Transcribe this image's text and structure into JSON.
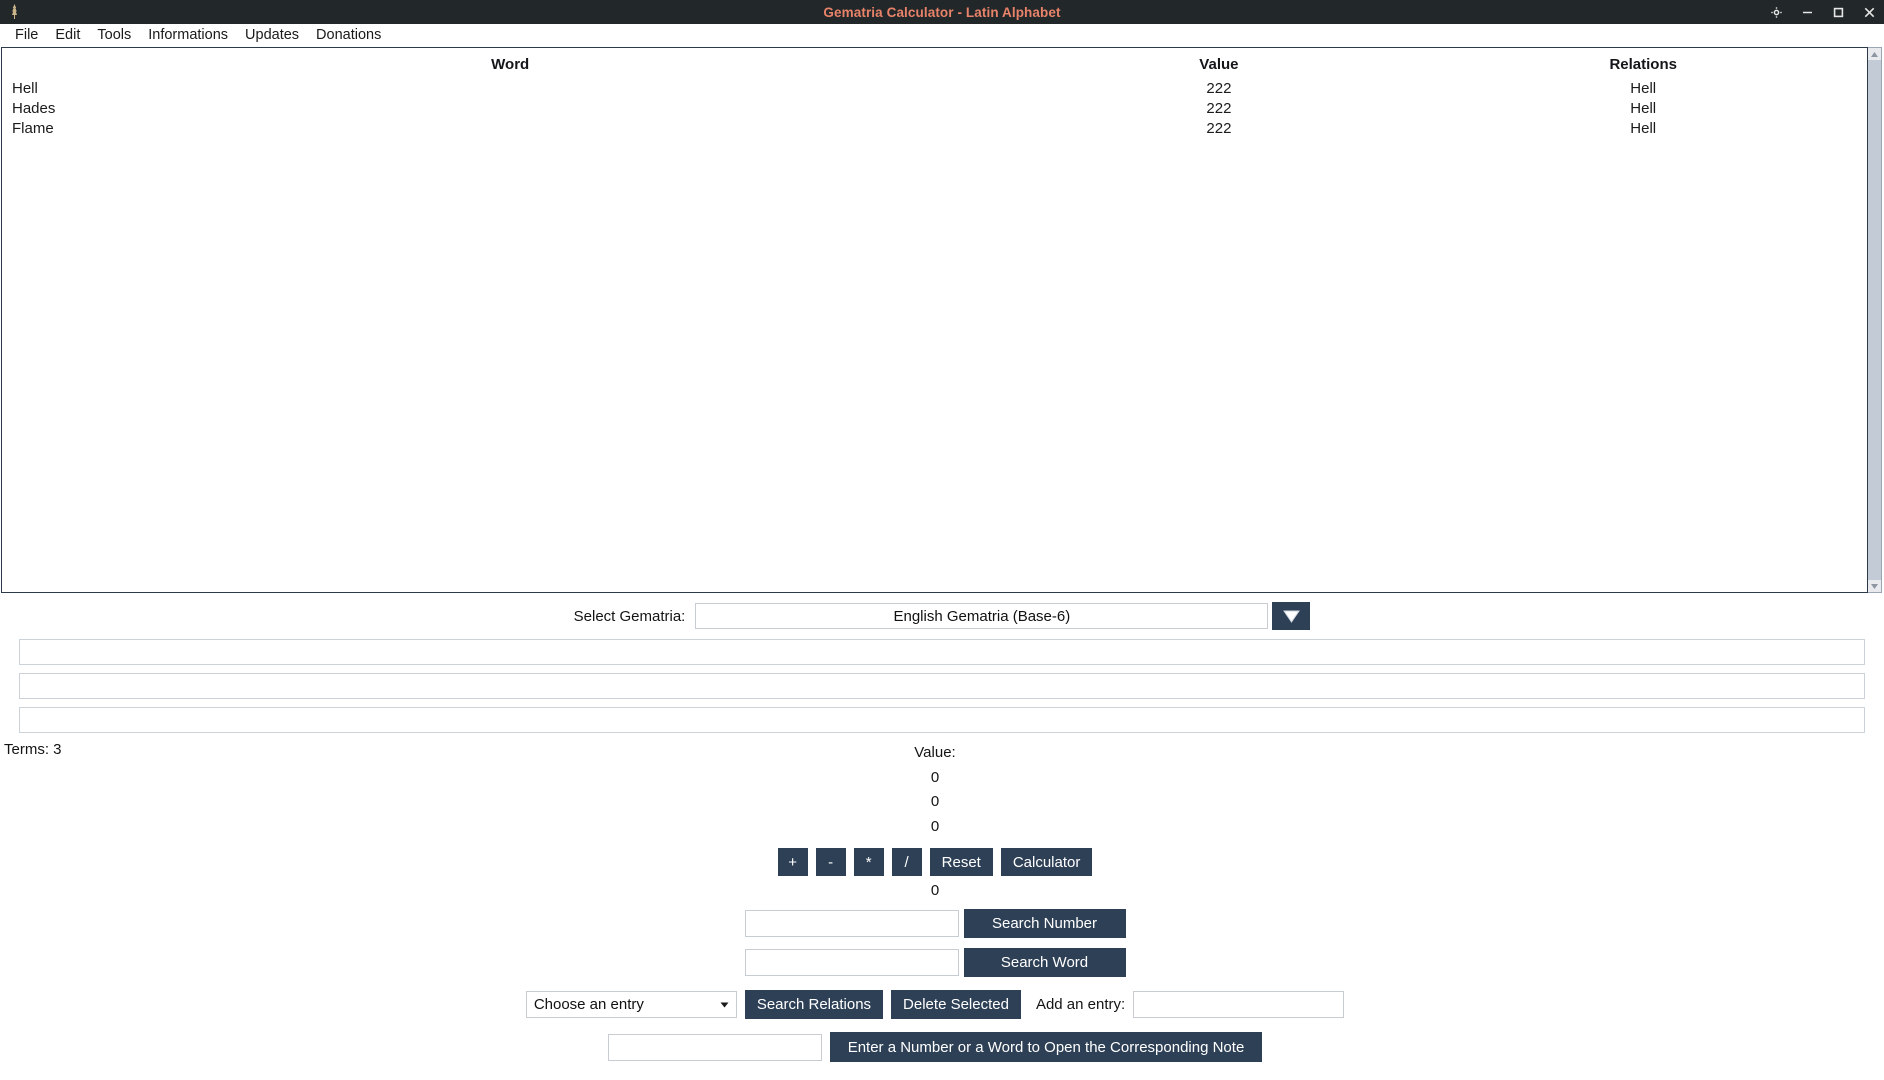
{
  "window": {
    "title": "Gematria Calculator - Latin Alphabet",
    "app_icon": "feather-icon",
    "controls": [
      {
        "name": "settings-icon",
        "glyph": "gear"
      },
      {
        "name": "minimize-icon",
        "glyph": "minimize"
      },
      {
        "name": "maximize-icon",
        "glyph": "maximize"
      },
      {
        "name": "close-icon",
        "glyph": "close"
      }
    ]
  },
  "menubar": {
    "items": [
      {
        "label": "File"
      },
      {
        "label": "Edit"
      },
      {
        "label": "Tools"
      },
      {
        "label": "Informations"
      },
      {
        "label": "Updates"
      },
      {
        "label": "Donations"
      }
    ]
  },
  "table": {
    "headers": {
      "word": "Word",
      "value": "Value",
      "relations": "Relations"
    },
    "rows": [
      {
        "word": "Hell",
        "value": "222",
        "relations": "Hell"
      },
      {
        "word": "Hades",
        "value": "222",
        "relations": "Hell"
      },
      {
        "word": "Flame",
        "value": "222",
        "relations": "Hell"
      }
    ]
  },
  "gematria": {
    "label": "Select Gematria:",
    "selected": "English Gematria (Base-6)",
    "dropdown_icon": "triangle-down-icon"
  },
  "text_fields": [
    {
      "name": "expression-field-1",
      "value": "",
      "placeholder": ""
    },
    {
      "name": "expression-field-2",
      "value": "",
      "placeholder": ""
    },
    {
      "name": "expression-field-3",
      "value": "",
      "placeholder": ""
    }
  ],
  "summary": {
    "terms_label": "Terms: 3",
    "value_header": "Value:",
    "values": [
      "0",
      "0",
      "0"
    ],
    "total": "0"
  },
  "calculator": {
    "operators": [
      {
        "name": "plus-button",
        "label": "+"
      },
      {
        "name": "minus-button",
        "label": "-"
      },
      {
        "name": "multiply-button",
        "label": "*"
      },
      {
        "name": "divide-button",
        "label": "/"
      }
    ],
    "reset_label": "Reset",
    "calculator_label": "Calculator"
  },
  "search": {
    "number": {
      "value": "",
      "placeholder": "",
      "button_label": "Search Number"
    },
    "word": {
      "value": "",
      "placeholder": "",
      "button_label": "Search Word"
    }
  },
  "entries": {
    "select_value": "Choose an entry",
    "select_caret": "caret-down-icon",
    "search_relations_label": "Search Relations",
    "delete_selected_label": "Delete Selected",
    "add_entry_label": "Add an entry:",
    "add_entry_value": "",
    "add_entry_placeholder": ""
  },
  "note": {
    "input_value": "",
    "input_placeholder": "",
    "button_label": "Enter a Number or a Word to Open the Corresponding Note"
  },
  "colors": {
    "titlebar_bg": "#222729",
    "title_text": "#e8836a",
    "button_bg": "#2e4056",
    "panel_border": "#2b3a4a"
  }
}
